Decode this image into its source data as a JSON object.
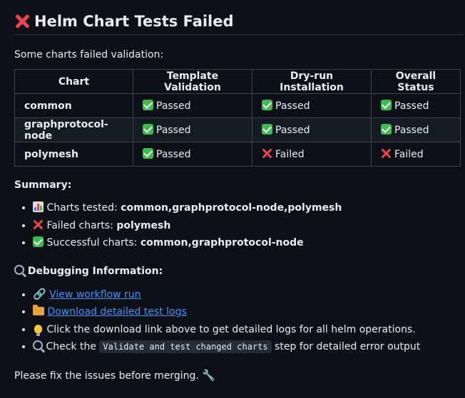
{
  "title": "Helm Chart Tests Failed",
  "intro": "Some charts failed validation:",
  "table": {
    "headers": [
      "Chart",
      "Template Validation",
      "Dry-run Installation",
      "Overall Status"
    ],
    "rows": [
      {
        "chart": "common",
        "template": "Passed",
        "dryrun": "Passed",
        "overall": "Passed"
      },
      {
        "chart": "graphprotocol-node",
        "template": "Passed",
        "dryrun": "Passed",
        "overall": "Passed"
      },
      {
        "chart": "polymesh",
        "template": "Passed",
        "dryrun": "Failed",
        "overall": "Failed"
      }
    ]
  },
  "summary": {
    "title": "Summary:",
    "items": [
      {
        "icon": "bar-chart-icon",
        "label": "Charts tested:",
        "value": "common,graphprotocol-node,polymesh"
      },
      {
        "icon": "cross-icon",
        "label": "Failed charts:",
        "value": "polymesh"
      },
      {
        "icon": "check-icon",
        "label": "Successful charts:",
        "value": "common,graphprotocol-node"
      }
    ]
  },
  "debug": {
    "title": "Debugging Information:",
    "workflow_link": "View workflow run",
    "logs_link": "Download detailed test logs",
    "tip": "Click the download link above to get detailed logs for all helm operations.",
    "check_prefix": "Check the",
    "check_code": "Validate and test changed charts",
    "check_suffix": "step for detailed error output"
  },
  "footer": "Please fix the issues before merging."
}
